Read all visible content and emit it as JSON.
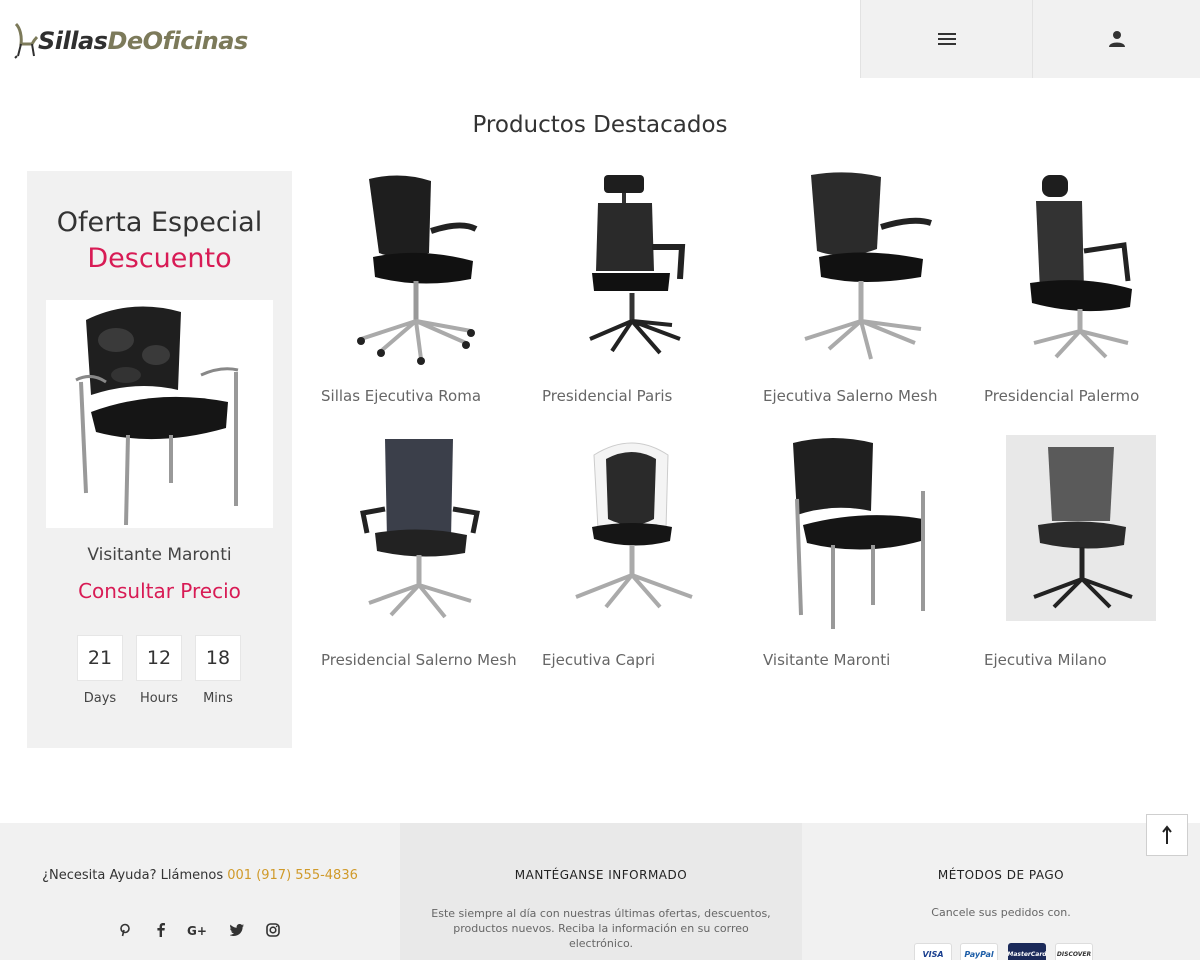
{
  "header": {
    "logo_part1": "Sillas",
    "logo_part2": "DeOficinas",
    "menu_icon": "hamburger-menu-icon",
    "user_icon": "user-icon"
  },
  "section_title": "Productos Destacados",
  "offer": {
    "title": "Oferta Especial",
    "subtitle": "Descuento",
    "product_name": "Visitante Maronti",
    "price_label": "Consultar Precio",
    "countdown": [
      {
        "value": "21",
        "label": "Days"
      },
      {
        "value": "12",
        "label": "Hours"
      },
      {
        "value": "18",
        "label": "Mins"
      }
    ]
  },
  "products": [
    {
      "name": "Sillas Ejecutiva Roma"
    },
    {
      "name": "Presidencial Paris"
    },
    {
      "name": "Ejecutiva Salerno Mesh"
    },
    {
      "name": "Presidencial Palermo"
    },
    {
      "name": "Presidencial Salerno Mesh"
    },
    {
      "name": "Ejecutiva Capri"
    },
    {
      "name": "Visitante Maronti"
    },
    {
      "name": "Ejecutiva Milano"
    }
  ],
  "footer": {
    "help_text": "¿Necesita Ayuda? Llámenos",
    "phone": "001 (917) 555-4836",
    "social_icons": [
      "pinterest-icon",
      "facebook-icon",
      "google-plus-icon",
      "twitter-icon",
      "instagram-icon"
    ],
    "newsletter_title": "MANTÉGANSE INFORMADO",
    "newsletter_text": "Este siempre al día con nuestras últimas ofertas, descuentos, productos nuevos. Reciba la información en su correo electrónico.",
    "payment_title": "MÉTODOS DE PAGO",
    "payment_text": "Cancele sus pedidos con.",
    "cards": [
      "VISA",
      "PayPal",
      "MasterCard",
      "DISCOVER"
    ]
  },
  "back_to_top_icon": "arrow-up-icon",
  "colors": {
    "accent": "#d81b55",
    "phone": "#d09a2a",
    "panel_bg": "#f1f1f1",
    "logo_olive": "#7c7a5a"
  }
}
